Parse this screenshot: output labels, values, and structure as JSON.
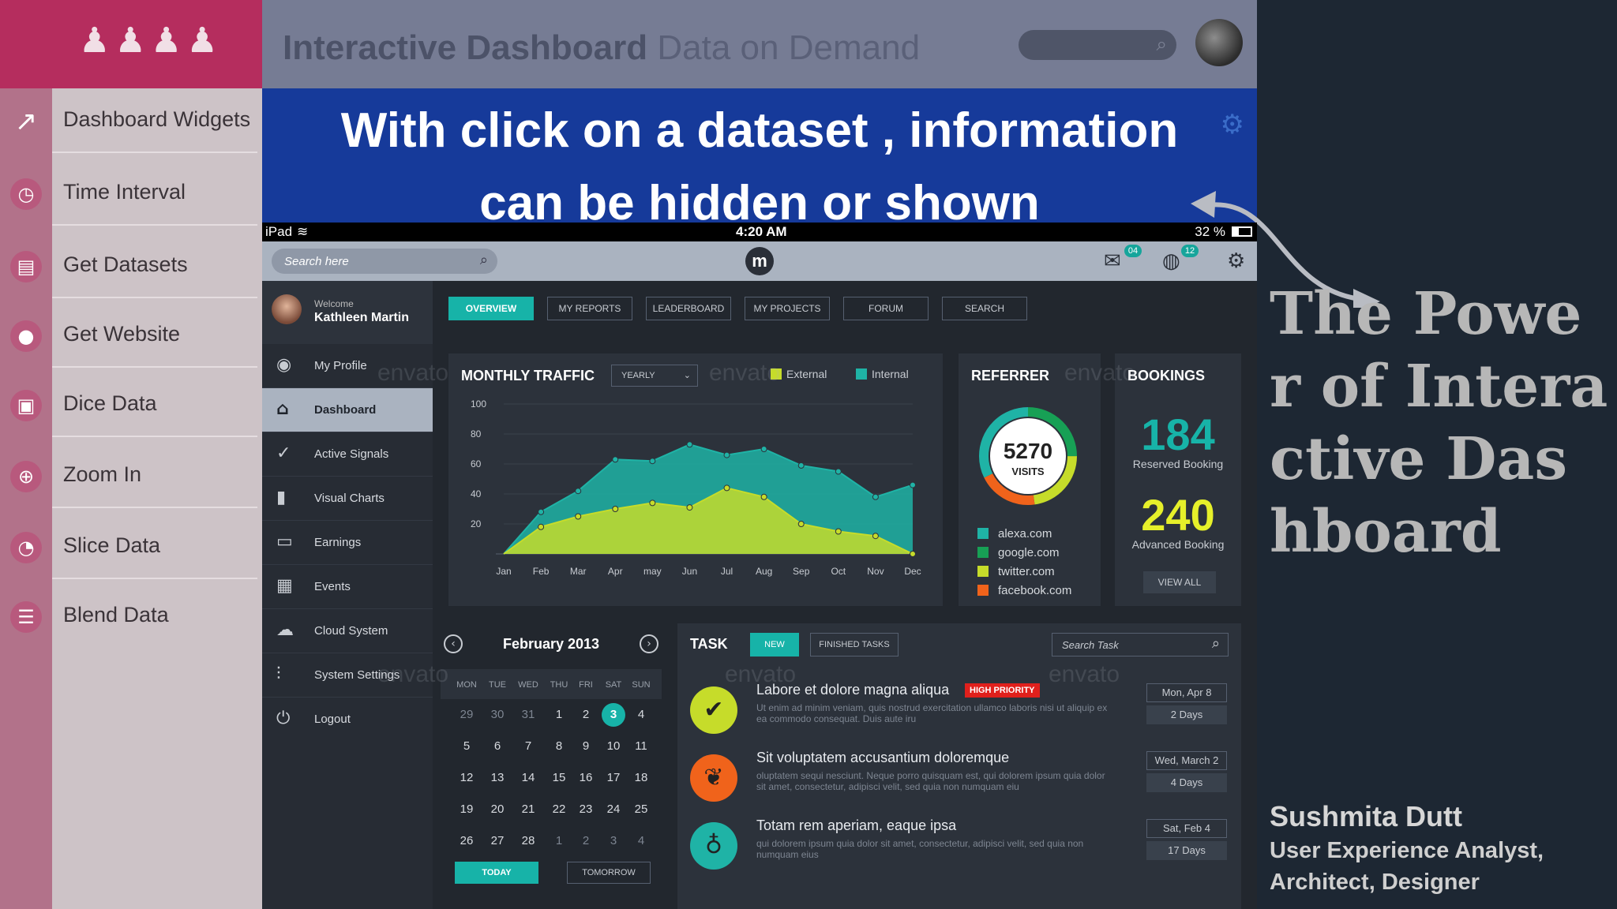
{
  "left_menu": {
    "items": [
      {
        "label": "Dashboard Widgets",
        "icon": "arrow-icon"
      },
      {
        "label": "Time Interval",
        "icon": "clock-icon"
      },
      {
        "label": "Get Datasets",
        "icon": "dataset-icon"
      },
      {
        "label": "Get Website",
        "icon": "location-icon"
      },
      {
        "label": "Dice Data",
        "icon": "dice-icon"
      },
      {
        "label": "Zoom In",
        "icon": "zoom-icon"
      },
      {
        "label": "Slice Data",
        "icon": "slice-icon"
      },
      {
        "label": "Blend Data",
        "icon": "blend-icon"
      }
    ]
  },
  "banner": {
    "title_bold": "Interactive Dashboard",
    "title_light": "Data on Demand"
  },
  "caption": {
    "line1": "With click on a dataset , information",
    "line2": "can be hidden or shown"
  },
  "status_bar": {
    "carrier": "iPad",
    "time": "4:20 AM",
    "battery": "32 %"
  },
  "app_bar": {
    "search_placeholder": "Search here",
    "logo": "m",
    "mail_badge": "04",
    "globe_badge": "12"
  },
  "sidebar": {
    "welcome": "Welcome",
    "user_name": "Kathleen Martin",
    "items": [
      {
        "label": "My Profile",
        "icon": "user-icon"
      },
      {
        "label": "Dashboard",
        "icon": "home-icon",
        "active": true
      },
      {
        "label": "Active Signals",
        "icon": "check-circle-icon"
      },
      {
        "label": "Visual Charts",
        "icon": "bar-chart-icon"
      },
      {
        "label": "Earnings",
        "icon": "wallet-icon"
      },
      {
        "label": "Events",
        "icon": "calendar-icon"
      },
      {
        "label": "Cloud System",
        "icon": "cloud-icon"
      },
      {
        "label": "System Settings",
        "icon": "sliders-icon"
      },
      {
        "label": "Logout",
        "icon": "power-icon"
      }
    ]
  },
  "tabs": [
    "OVERVIEW",
    "MY REPORTS",
    "LEADERBOARD",
    "MY PROJECTS",
    "FORUM",
    "SEARCH"
  ],
  "watermark": "envato",
  "traffic": {
    "title": "MONTHLY TRAFFIC",
    "period": "YEARLY",
    "legend_external": "External",
    "legend_internal": "Internal"
  },
  "chart_data": {
    "type": "area",
    "title": "MONTHLY TRAFFIC",
    "categories": [
      "Jan",
      "Feb",
      "Mar",
      "Apr",
      "may",
      "Jun",
      "Jul",
      "Aug",
      "Sep",
      "Oct",
      "Nov",
      "Dec"
    ],
    "series": [
      {
        "name": "Internal",
        "color": "#1fb3a6",
        "values": [
          0,
          28,
          42,
          63,
          62,
          73,
          66,
          70,
          59,
          55,
          38,
          46
        ]
      },
      {
        "name": "External",
        "color": "#c6dc2a",
        "values": [
          0,
          18,
          25,
          30,
          34,
          31,
          44,
          38,
          20,
          15,
          12,
          0
        ]
      }
    ],
    "ylim": [
      0,
      100
    ],
    "yticks": [
      20,
      40,
      60,
      80,
      100
    ],
    "grid": true,
    "legend": "top"
  },
  "referrer": {
    "title": "REFERRER",
    "visits_value": "5270",
    "visits_label": "VISITS",
    "items": [
      {
        "label": "alexa.com",
        "color": "#1fb3a6"
      },
      {
        "label": "google.com",
        "color": "#17a055"
      },
      {
        "label": "twitter.com",
        "color": "#c6dc2a"
      },
      {
        "label": "facebook.com",
        "color": "#f0631b"
      }
    ]
  },
  "bookings": {
    "title": "BOOKINGS",
    "reserved_value": "184",
    "reserved_label": "Reserved Booking",
    "advanced_value": "240",
    "advanced_label": "Advanced Booking",
    "view_all": "VIEW ALL"
  },
  "calendar": {
    "month": "February 2013",
    "weekdays": [
      "MON",
      "TUE",
      "WED",
      "THU",
      "FRI",
      "SAT",
      "SUN"
    ],
    "weeks": [
      [
        "29",
        "30",
        "31",
        "1",
        "2",
        "3",
        "4"
      ],
      [
        "5",
        "6",
        "7",
        "8",
        "9",
        "10",
        "11"
      ],
      [
        "12",
        "13",
        "14",
        "15",
        "16",
        "17",
        "18"
      ],
      [
        "19",
        "20",
        "21",
        "22",
        "23",
        "24",
        "25"
      ],
      [
        "26",
        "27",
        "28",
        "1",
        "2",
        "3",
        "4"
      ]
    ],
    "selected": "3",
    "today": "TODAY",
    "tomorrow": "TOMORROW"
  },
  "tasks": {
    "title": "TASK",
    "tab_new": "NEW",
    "tab_finished": "FINISHED TASKS",
    "search_placeholder": "Search Task",
    "items": [
      {
        "title": "Labore et dolore magna aliqua",
        "badge": "HIGH PRIORITY",
        "desc": "Ut enim ad minim veniam, quis nostrud exercitation ullamco laboris nisi ut aliquip ex ea commodo consequat. Duis aute iru",
        "date": "Mon, Apr 8",
        "duration": "2 Days",
        "icon": "check-icon",
        "color": "#c6dc2a"
      },
      {
        "title": "Sit voluptatem accusantium doloremque",
        "badge": "",
        "desc": "oluptatem sequi nesciunt. Neque porro quisquam est, qui dolorem ipsum quia dolor sit amet, consectetur, adipisci velit, sed quia non numquam eiu",
        "date": "Wed, March 2",
        "duration": "4 Days",
        "icon": "leaf-icon",
        "color": "#f0631b"
      },
      {
        "title": "Totam rem aperiam, eaque ipsa",
        "badge": "",
        "desc": "qui dolorem ipsum quia dolor sit amet, consectetur, adipisci velit, sed quia non numquam eius",
        "date": "Sat, Feb 4",
        "duration": "17 Days",
        "icon": "bulb-icon",
        "color": "#1fb3a6"
      }
    ]
  },
  "right_text": {
    "power": "The Power of Interactive Dashboard",
    "author": "Sushmita Dutt",
    "role_line1": "User Experience Analyst,",
    "role_line2": "Architect, Designer"
  }
}
